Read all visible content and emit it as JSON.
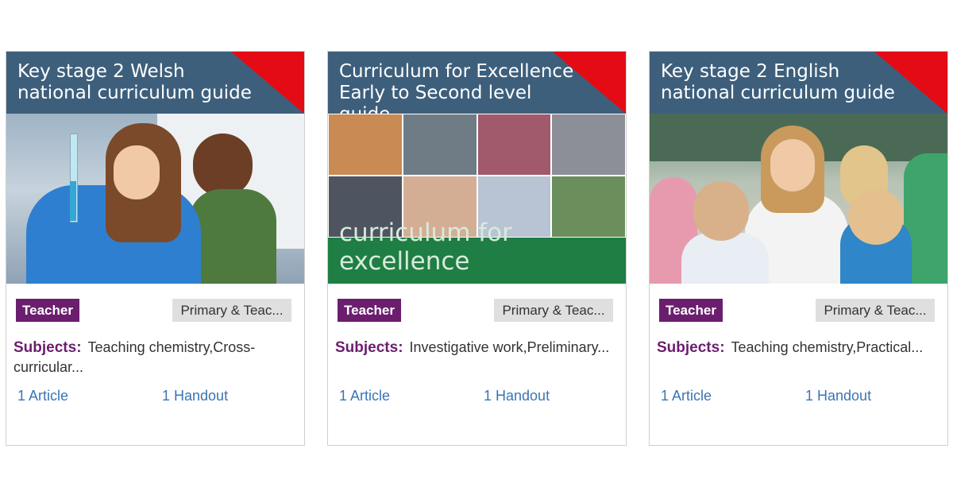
{
  "cards": [
    {
      "title": "Key stage 2 Welsh national curriculum guide",
      "image_alt": "girl with test tube in classroom",
      "audience_tag": "Teacher",
      "level_tag": "Primary & Teac...",
      "subjects_label": "Subjects:",
      "subjects_text": "Teaching chemistry,Cross-curricular...",
      "article_link": "1 Article",
      "handout_link": "1 Handout"
    },
    {
      "title": "Curriculum for Excellence Early to Second level guide",
      "image_alt": "collage of students, curriculum for excellence",
      "image_caption": "curriculum for excellence",
      "audience_tag": "Teacher",
      "level_tag": "Primary & Teac...",
      "subjects_label": "Subjects:",
      "subjects_text": "Investigative work,Preliminary...",
      "article_link": "1 Article",
      "handout_link": "1 Handout"
    },
    {
      "title": "Key stage 2 English national curriculum guide",
      "image_alt": "teacher with children looking at test tube",
      "audience_tag": "Teacher",
      "level_tag": "Primary & Teac...",
      "subjects_label": "Subjects:",
      "subjects_text": "Teaching chemistry,Practical...",
      "article_link": "1 Article",
      "handout_link": "1 Handout"
    }
  ],
  "colors": {
    "header_bg": "#3d5f7c",
    "corner_accent": "#e40b14",
    "tag_purple": "#6b1e6e",
    "link_blue": "#3a74b6",
    "cfe_green": "#1f7e43"
  }
}
